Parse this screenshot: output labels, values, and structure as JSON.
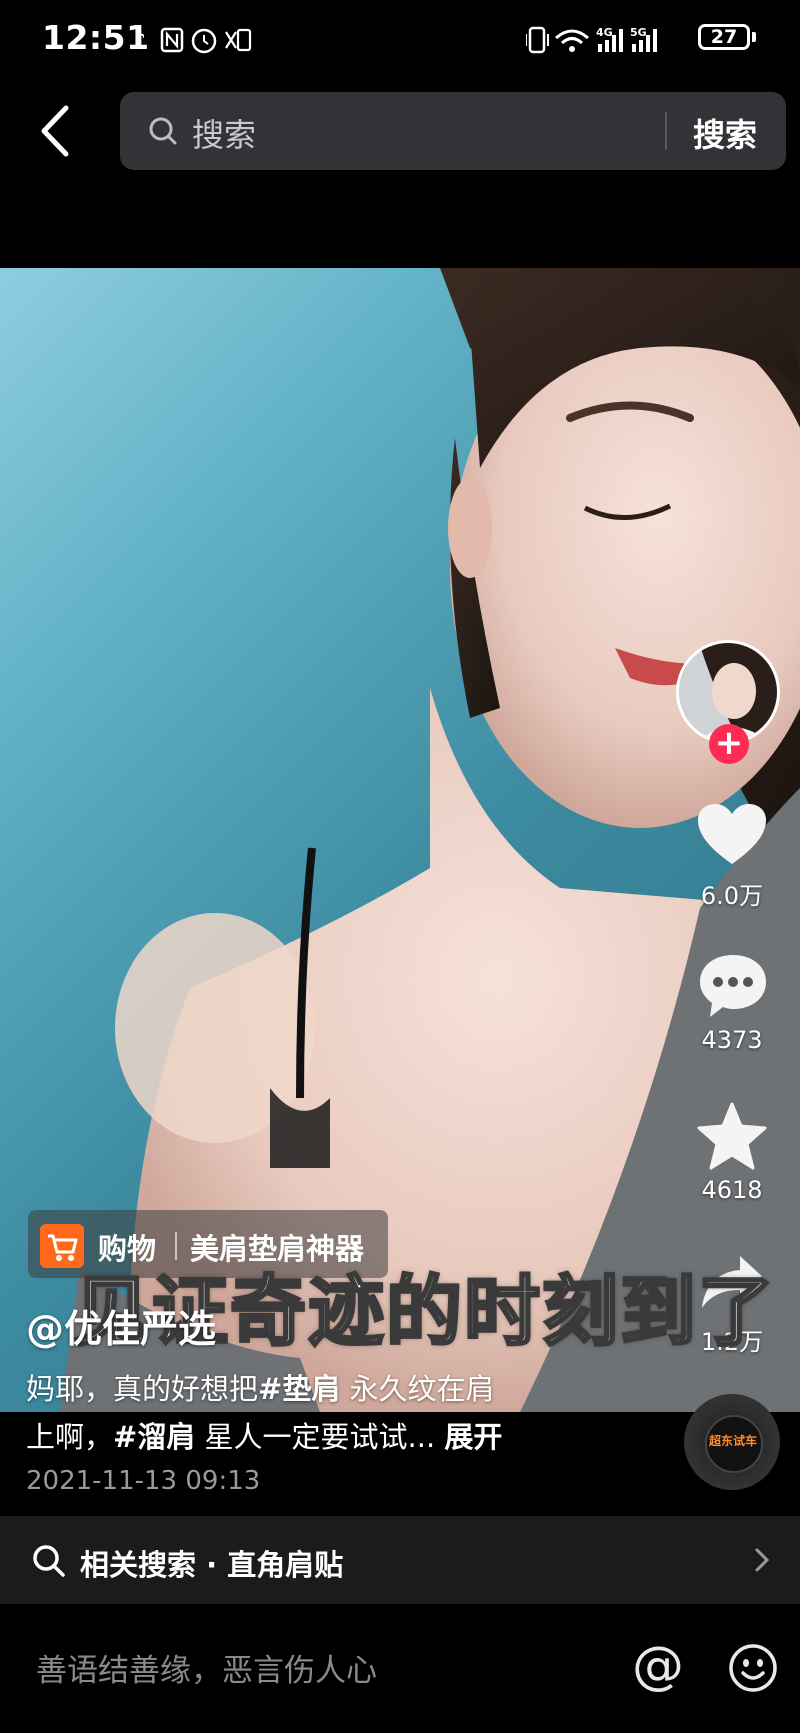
{
  "status_bar": {
    "time": "12:51",
    "battery": "27",
    "network_4g": "4G",
    "network_5g": "5G"
  },
  "search": {
    "placeholder": "搜索",
    "button_label": "搜索"
  },
  "video": {
    "subtitle": "见证奇迹的时刻到了",
    "shop_tag": {
      "label": "购物",
      "product": "美肩垫肩神器"
    },
    "author": "@优佳严选",
    "description": {
      "line1_before": "妈耶，真的好想把",
      "hashtag1": "#垫肩",
      "line1_after": " 永久纹在肩",
      "line2_before": "上啊，",
      "hashtag2": "#溜肩",
      "line2_after": " 星人一定要试试... ",
      "expand": "展开"
    },
    "timestamp": "2021-11-13 09:13",
    "music_label": "超东试车"
  },
  "actions": {
    "likes": "6.0万",
    "comments": "4373",
    "favorites": "4618",
    "shares": "1.2万"
  },
  "related_search": {
    "text": "相关搜索 · 直角肩贴"
  },
  "comment_bar": {
    "placeholder": "善语结善缘，恶言伤人心",
    "at_symbol": "@"
  },
  "colors": {
    "accent_red": "#fe2c55",
    "cart_orange": "#ff6a1a",
    "background": "#000000"
  },
  "icons": [
    "back-icon",
    "search-icon",
    "heart-icon",
    "comment-icon",
    "star-icon",
    "share-icon",
    "cart-icon",
    "chevron-right-icon",
    "at-icon",
    "emoji-icon"
  ]
}
